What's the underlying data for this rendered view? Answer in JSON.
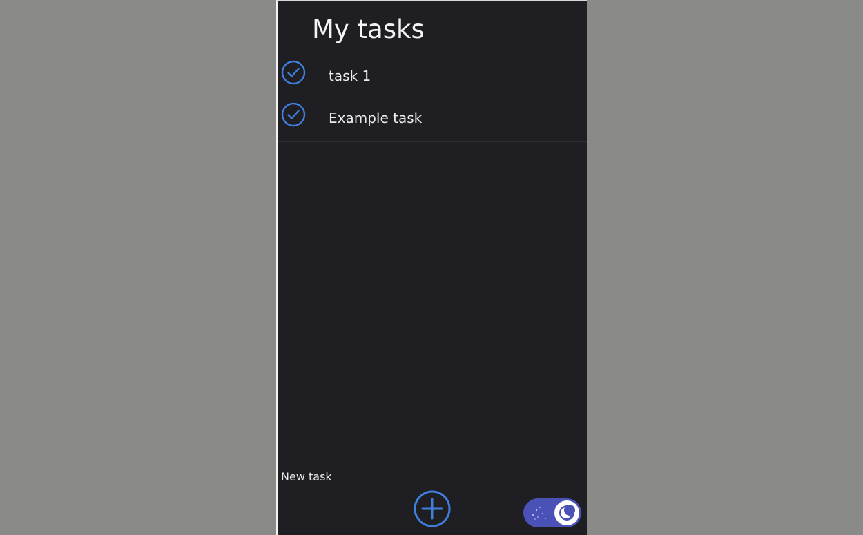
{
  "header": {
    "title": "My tasks"
  },
  "tasks": [
    {
      "label": "task 1",
      "icon": "check-circle-icon",
      "completed": true
    },
    {
      "label": "Example task",
      "icon": "check-circle-icon",
      "completed": true
    }
  ],
  "footer": {
    "new_task_label": "New task",
    "add_icon": "plus-circle-icon",
    "theme_toggle": {
      "state": "dark",
      "icon": "moon-icon"
    }
  },
  "colors": {
    "background": "#1f1f23",
    "accent": "#3f7fdf",
    "toggle": "#4a52b8",
    "text": "#ececec"
  }
}
